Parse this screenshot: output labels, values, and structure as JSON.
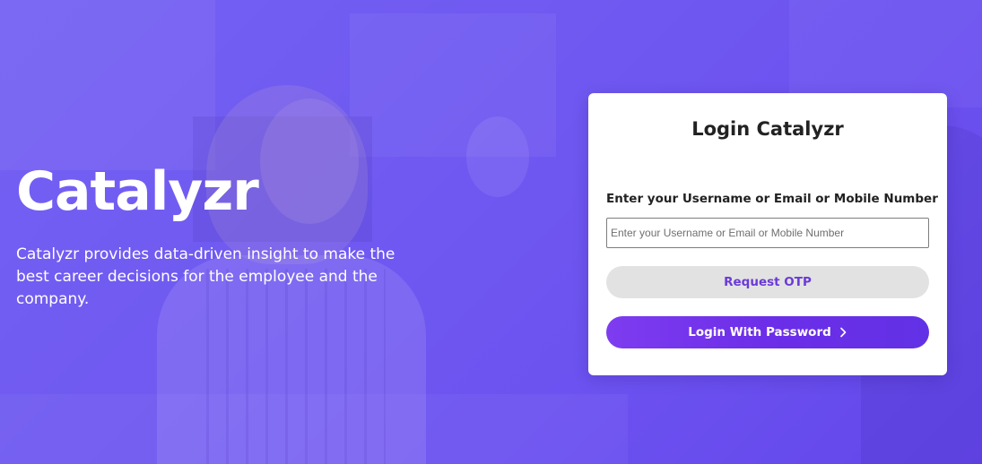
{
  "brand": {
    "title": "Catalyzr",
    "description": "Catalyzr provides data-driven insight to make the best career decisions for the employee and the company."
  },
  "login": {
    "title": "Login Catalyzr",
    "field_label": "Enter your Username or Email or Mobile Number",
    "field_placeholder": "Enter your Username or Email or Mobile Number",
    "field_value": "",
    "request_otp_label": "Request OTP",
    "password_login_label": "Login With Password",
    "password_login_icon": "chevron-right-icon"
  },
  "colors": {
    "background_accent": "#6f5cf2",
    "primary": "#6c2ee8",
    "otp_button_bg": "#e2e2e2",
    "otp_button_text": "#6a3ad8",
    "card_bg": "#ffffff"
  }
}
